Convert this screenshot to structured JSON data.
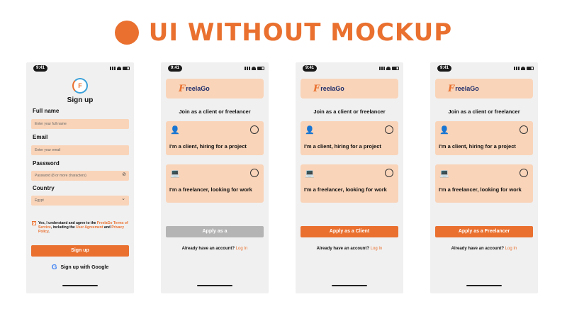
{
  "header": {
    "title": "UI WITHOUT MOCKUP"
  },
  "status_time": "9:41",
  "signup": {
    "logo_text": "F",
    "title": "Sign up",
    "fullname_label": "Full name",
    "fullname_placeholder": "Enter your full name",
    "email_label": "Email",
    "email_placeholder": "Enter your email",
    "password_label": "Password",
    "password_placeholder": "Password (8 or more characters)",
    "country_label": "Country",
    "country_value": "Egypt",
    "terms_text_1": "Yes, I understand and agree to the",
    "terms_link_1": "FreelaGo Terms of Service",
    "terms_text_2": ", including the",
    "terms_link_2": "User Agreement",
    "terms_text_3": "and",
    "terms_link_3": "Privacy Policy",
    "terms_text_4": ".",
    "signup_button": "Sign up",
    "google_button": "Sign up with Google"
  },
  "join": {
    "brand_f": "F",
    "brand_word": "reelaGo",
    "title": "Join as a client or freelancer",
    "client_option": "I'm a client, hiring for a project",
    "freelancer_option": "I'm a freelancer, looking for work",
    "login_prompt": "Already have an account?",
    "login_link": "Log In"
  },
  "screens": [
    {
      "apply_label": "Apply as a",
      "state": "disabled"
    },
    {
      "apply_label": "Apply as a Client",
      "state": "active"
    },
    {
      "apply_label": "Apply as a Freelancer",
      "state": "active"
    }
  ],
  "colors": {
    "accent": "#e9702f",
    "field_bg": "#f9d4b9",
    "disabled": "#b4b4b4",
    "brand_text": "#1f2d6b"
  },
  "icons": [
    "client-icon",
    "freelancer-icon",
    "eye-icon",
    "chevron-down-icon",
    "google-icon",
    "checkbox-icon"
  ]
}
